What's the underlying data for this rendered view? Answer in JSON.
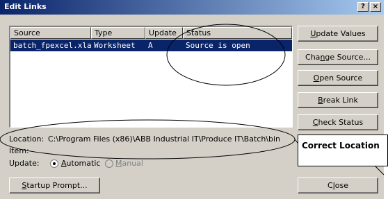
{
  "window": {
    "title": "Edit Links",
    "help_button": "?",
    "close_button": "×"
  },
  "columns": [
    "Source",
    "Type",
    "Update",
    "Status"
  ],
  "rows": [
    {
      "source": "batch_fpexcel.xla",
      "type": "Worksheet",
      "update": "A",
      "status": "Source is open"
    }
  ],
  "buttons": {
    "update_values": {
      "pre": "",
      "key": "U",
      "post": "pdate Values"
    },
    "change_source": {
      "pre": "Cha",
      "key": "n",
      "post": "ge Source..."
    },
    "open_source": {
      "pre": "",
      "key": "O",
      "post": "pen Source"
    },
    "break_link": {
      "pre": "",
      "key": "B",
      "post": "reak Link"
    },
    "check_status": {
      "pre": "",
      "key": "C",
      "post": "heck Status"
    },
    "startup_prompt": {
      "pre": "",
      "key": "S",
      "post": "tartup Prompt..."
    },
    "close": {
      "pre": "C",
      "key": "l",
      "post": "ose"
    }
  },
  "location": {
    "label": "Location:",
    "value": "C:\\Program Files (x86)\\ABB Industrial IT\\Produce IT\\Batch\\bin"
  },
  "item": {
    "label": "Item:",
    "value": ""
  },
  "update_mode": {
    "label": "Update:",
    "automatic": {
      "pre": "",
      "key": "A",
      "post": "utomatic",
      "selected": true
    },
    "manual": {
      "pre": "",
      "key": "M",
      "post": "anual",
      "selected": false,
      "disabled": true
    }
  },
  "annotation": {
    "text": "Correct Location"
  }
}
